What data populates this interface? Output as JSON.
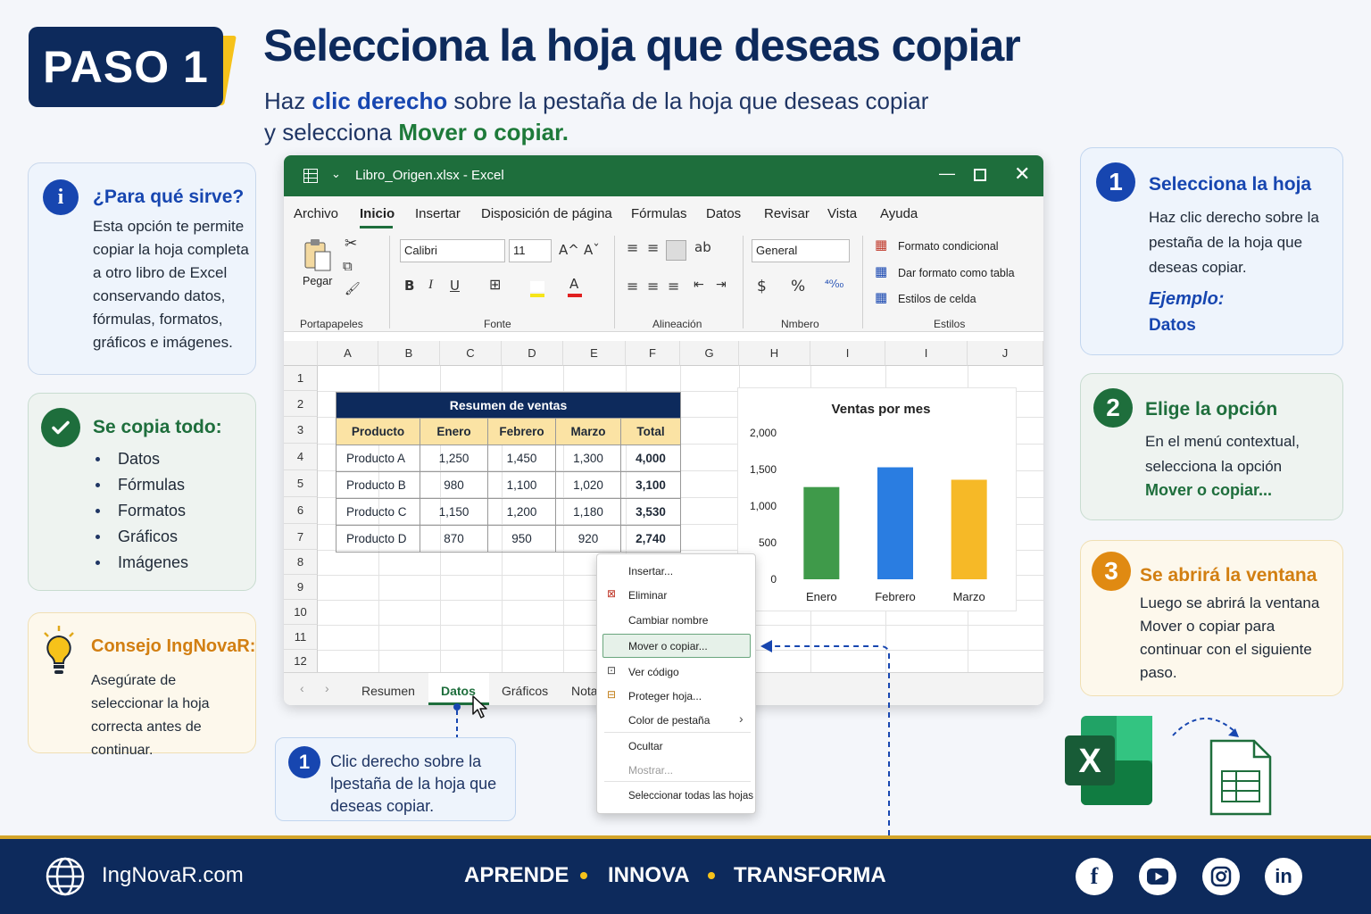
{
  "header": {
    "step_badge": "PASO 1",
    "title": "Selecciona la hoja que deseas copiar",
    "sub_1": "Haz ",
    "sub_bold": "clic derecho",
    "sub_2": " sobre la pestaña de la hoja que deseas copiar",
    "sub_3": "y selecciona ",
    "sub_green": "Mover o copiar."
  },
  "info_card": {
    "heading": "¿Para qué sirve?",
    "body": "Esta opción te permite copiar la hoja completa a otro libro de Excel conservando datos, fórmulas, formatos, gráficos e imágenes."
  },
  "todo_card": {
    "heading": "Se copia todo:",
    "items": [
      "Datos",
      "Fórmulas",
      "Formatos",
      "Gráficos",
      "Imágenes"
    ]
  },
  "tip_card": {
    "heading": "Consejo IngNovaR:",
    "body": "Asegúrate de seleccionar la hoja correcta antes de continuar."
  },
  "excel": {
    "window_title": "Libro_Origen.xlsx - Excel",
    "menu": [
      "Archivo",
      "Inicio",
      "Insertar",
      "Disposición de página",
      "Fórmulas",
      "Datos",
      "Revisar",
      "Vista",
      "Ayuda"
    ],
    "ribbon": {
      "paste_label": "Pegar",
      "font_name": "Calibri",
      "font_size": "11",
      "number_format": "General",
      "conditional": "Formato condicional",
      "format_table": "Dar formato como tabla",
      "cell_styles": "Estilos de celda",
      "groups": [
        "Portapapeles",
        "Fonte",
        "Alineación",
        "Nmbero",
        "Estilos"
      ]
    },
    "columns": [
      "A",
      "B",
      "C",
      "D",
      "E",
      "F",
      "G",
      "H",
      "I",
      "I",
      "J"
    ],
    "rows": [
      "1",
      "2",
      "3",
      "4",
      "5",
      "6",
      "7",
      "8",
      "9",
      "10",
      "11",
      "12"
    ],
    "table": {
      "title": "Resumen de ventas",
      "headers": [
        "Producto",
        "Enero",
        "Febrero",
        "Marzo",
        "Total"
      ],
      "rows": [
        [
          "Producto A",
          "1,250",
          "1,450",
          "1,300",
          "4,000"
        ],
        [
          "Producto B",
          "980",
          "1,100",
          "1,020",
          "3,100"
        ],
        [
          "Producto C",
          "1,150",
          "1,200",
          "1,180",
          "3,530"
        ],
        [
          "Producto D",
          "870",
          "950",
          "920",
          "2,740"
        ]
      ]
    },
    "sheet_tabs": [
      "Resumen",
      "Datos",
      "Gráficos",
      "Nota"
    ],
    "active_tab": "Datos"
  },
  "chart_data": {
    "type": "bar",
    "title": "Ventas por mes",
    "categories": [
      "Enero",
      "Febrero",
      "Marzo"
    ],
    "values": [
      1260,
      1530,
      1360
    ],
    "colors": [
      "#3f9a4a",
      "#2a7de1",
      "#f6b927"
    ],
    "ylim": [
      0,
      2000
    ],
    "yticks": [
      "0",
      "500",
      "1,000",
      "1,500",
      "2,000"
    ],
    "grid": false
  },
  "context_menu": {
    "items": [
      "Insertar...",
      "Eliminar",
      "Cambiar nombre",
      "Mover o copiar...",
      "Ver código",
      "Proteger hoja...",
      "Color de pestaña",
      "Ocultar",
      "Mostrar...",
      "Seleccionar todas las hojas"
    ],
    "highlighted": "Mover o copiar...",
    "disabled": "Mostrar..."
  },
  "callout": {
    "number": "1",
    "text": "Clic derecho sobre la lpestaña de la hoja que deseas copiar."
  },
  "steps": [
    {
      "number": "1",
      "title": "Selecciona la hoja",
      "body": "Haz clic derecho sobre la pestaña de la hoja que deseas copiar.",
      "example_label": "Ejemplo:",
      "example_value": "Datos",
      "color": "#1746b0"
    },
    {
      "number": "2",
      "title": "Elige la opción",
      "body": "En el menú contextual, selecciona la opción",
      "highlight": "Mover o copiar...",
      "color": "#1e6e3c"
    },
    {
      "number": "3",
      "title": "Se abrirá la ventana",
      "body": "Luego se abrirá la ventana Mover o copiar para continuar con el siguiente paso.",
      "color": "#e08a12"
    }
  ],
  "footer": {
    "site": "IngNovaR.com",
    "slogan": [
      "APRENDE",
      "INNOVA",
      "TRANSFORMA"
    ],
    "social": [
      "facebook-icon",
      "youtube-icon",
      "instagram-icon",
      "linkedin-icon"
    ]
  }
}
